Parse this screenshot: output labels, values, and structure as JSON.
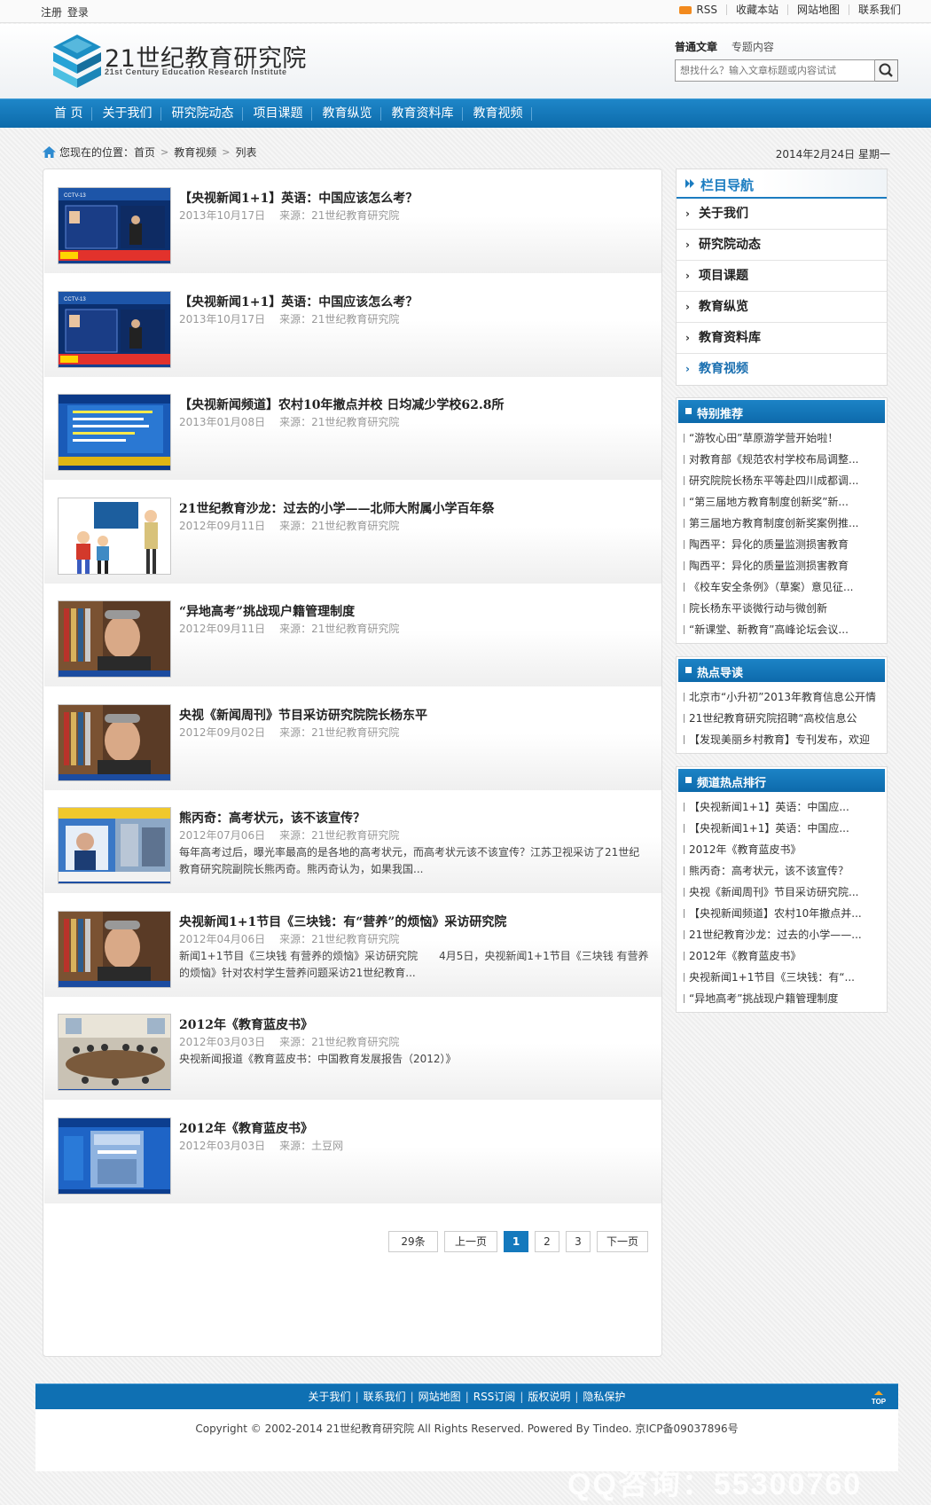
{
  "topbar": {
    "register": "注册",
    "login": "登录",
    "rss": "RSS",
    "favorite": "收藏本站",
    "sitemap": "网站地图",
    "contact": "联系我们"
  },
  "header": {
    "logo_title": "21世纪教育研究院",
    "logo_sub": "21st Century Education Research Institute",
    "search_tab_articles": "普通文章",
    "search_tab_topics": "专题内容",
    "search_placeholder": "想找什么？输入文章标题或内容试试"
  },
  "nav": [
    "首 页",
    "关于我们",
    "研究院动态",
    "项目课题",
    "教育纵览",
    "教育资料库",
    "教育视频"
  ],
  "breadcrumb": {
    "prefix": "您现在的位置：",
    "home": "首页",
    "section": "教育视频",
    "page": "列表",
    "date": "2014年2月24日 星期一"
  },
  "articles": [
    {
      "title": "【央视新闻1+1】英语：中国应该怎么考？",
      "date": "2013年10月17日",
      "source": "来源：21世纪教育研究院",
      "desc": "",
      "thumb": "studio"
    },
    {
      "title": "【央视新闻1+1】英语：中国应该怎么考？",
      "date": "2013年10月17日",
      "source": "来源：21世纪教育研究院",
      "desc": "",
      "thumb": "studio"
    },
    {
      "title": "【央视新闻频道】农村10年撤点并校 日均减少学校62.8所",
      "date": "2013年01月08日",
      "source": "来源：21世纪教育研究院",
      "desc": "",
      "thumb": "screen"
    },
    {
      "title": "21世纪教育沙龙：过去的小学——北师大附属小学百年祭",
      "date": "2012年09月11日",
      "source": "来源：21世纪教育研究院",
      "desc": "",
      "thumb": "cartoon"
    },
    {
      "title": "“异地高考”挑战现户籍管理制度",
      "date": "2012年09月11日",
      "source": "来源：21世纪教育研究院",
      "desc": "",
      "thumb": "person"
    },
    {
      "title": "央视《新闻周刊》节目采访研究院院长杨东平",
      "date": "2012年09月02日",
      "source": "来源：21世纪教育研究院",
      "desc": "",
      "thumb": "person"
    },
    {
      "title": "熊丙奇：高考状元，该不该宣传？",
      "date": "2012年07月06日",
      "source": "来源：21世纪教育研究院",
      "desc": "每年高考过后，曝光率最高的是各地的高考状元，而高考状元该不该宣传？江苏卫视采访了21世纪教育研究院副院长熊丙奇。熊丙奇认为，如果我国...",
      "thumb": "news"
    },
    {
      "title": "央视新闻1+1节目《三块钱：有“营养”的烦恼》采访研究院",
      "date": "2012年04月06日",
      "source": "来源：21世纪教育研究院",
      "desc": "新闻1+1节目《三块钱 有营养的烦恼》采访研究院　　4月5日，央视新闻1+1节目《三块钱 有营养的烦恼》针对农村学生营养问题采访21世纪教育...",
      "thumb": "person"
    },
    {
      "title": "2012年《教育蓝皮书》",
      "date": "2012年03月03日",
      "source": "来源：21世纪教育研究院",
      "desc": "央视新闻报道《教育蓝皮书：中国教育发展报告（2012）》",
      "thumb": "meeting"
    },
    {
      "title": "2012年《教育蓝皮书》",
      "date": "2012年03月03日",
      "source": "来源：土豆网",
      "desc": "",
      "thumb": "book"
    }
  ],
  "pager": {
    "count": "29条",
    "prev": "上一页",
    "pages": [
      "1",
      "2",
      "3"
    ],
    "next": "下一页"
  },
  "sidebar": {
    "catnav_title": "栏目导航",
    "catnav_items": [
      "关于我们",
      "研究院动态",
      "项目课题",
      "教育纵览",
      "教育资料库",
      "教育视频"
    ],
    "recommend_title": "特别推荐",
    "recommend_items": [
      "“游牧心田”草原游学营开始啦！",
      "对教育部《规范农村学校布局调整...",
      "研究院院长杨东平等赴四川成都调...",
      "“第三届地方教育制度创新奖”新...",
      "第三届地方教育制度创新奖案例推...",
      "陶西平：异化的质量监测损害教育",
      "陶西平：异化的质量监测损害教育",
      "《校车安全条例》（草案）意见征...",
      "院长杨东平谈微行动与微创新",
      "“新课堂、新教育”高峰论坛会议..."
    ],
    "hot_title": "热点导读",
    "hot_items": [
      "北京市“小升初”2013年教育信息公开情",
      "21世纪教育研究院招聘“高校信息公",
      "【发现美丽乡村教育】专刊发布，欢迎"
    ],
    "rank_title": "频道热点排行",
    "rank_items": [
      "【央视新闻1+1】英语：中国应...",
      "【央视新闻1+1】英语：中国应...",
      "2012年《教育蓝皮书》",
      "熊丙奇：高考状元，该不该宣传？",
      "央视《新闻周刊》节目采访研究院...",
      "【央视新闻频道】农村10年撤点并...",
      "21世纪教育沙龙：过去的小学——...",
      "2012年《教育蓝皮书》",
      "央视新闻1+1节目《三块钱：有“...",
      "“异地高考”挑战现户籍管理制度"
    ]
  },
  "footer": {
    "links": [
      "关于我们",
      "联系我们",
      "网站地图",
      "RSS订阅",
      "版权说明",
      "隐私保护"
    ],
    "top": "TOP",
    "copyright": "Copyright © 2002-2014 21世纪教育研究院 All Rights Reserved. Powered By Tindeo. 京ICP备09037896号",
    "watermark": "QQ咨询：55300760"
  },
  "colors": {
    "nav_blue": "#1479bd",
    "accent": "#1b7cc0",
    "rss": "#f28a1e"
  }
}
